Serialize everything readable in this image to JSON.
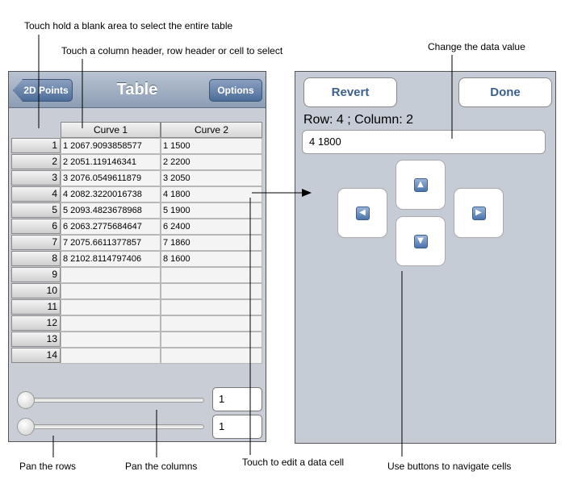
{
  "annotations": {
    "select_table": "Touch hold a blank area to select the entire table",
    "select_header_cell": "Touch a column header, row header or cell to select",
    "change_value": "Change the data value",
    "pan_rows": "Pan the rows",
    "pan_columns": "Pan the columns",
    "edit_cell": "Touch to edit a data cell",
    "navigate_cells": "Use buttons to navigate cells"
  },
  "navbar": {
    "back_label": "2D Points",
    "title": "Table",
    "options_label": "Options"
  },
  "table": {
    "columns": [
      "Curve 1",
      "Curve 2"
    ],
    "row_headers": [
      "1",
      "2",
      "3",
      "4",
      "5",
      "6",
      "7",
      "8",
      "9",
      "10",
      "11",
      "12",
      "13",
      "14"
    ],
    "rows": [
      [
        "1 2067.9093858577",
        "1 1500"
      ],
      [
        "2 2051.119146341",
        "2 2200"
      ],
      [
        "3 2076.0549611879",
        "3 2050"
      ],
      [
        "4 2082.3220016738",
        "4 1800"
      ],
      [
        "5 2093.4823678968",
        "5 1900"
      ],
      [
        "6 2063.2775684647",
        "6 2400"
      ],
      [
        "7 2075.6611377857",
        "7 1860"
      ],
      [
        "8 2102.8114797406",
        "8 1600"
      ],
      [
        "",
        ""
      ],
      [
        "",
        ""
      ],
      [
        "",
        ""
      ],
      [
        "",
        ""
      ],
      [
        "",
        ""
      ],
      [
        "",
        ""
      ]
    ]
  },
  "sliders": {
    "rows_value": "1",
    "columns_value": "1"
  },
  "editor": {
    "revert_label": "Revert",
    "done_label": "Done",
    "position": "Row: 4 ; Column: 2",
    "value": "4 1800"
  },
  "icons": {
    "up": "arrow-up-icon",
    "down": "arrow-down-icon",
    "left": "arrow-left-icon",
    "right": "arrow-right-icon"
  }
}
